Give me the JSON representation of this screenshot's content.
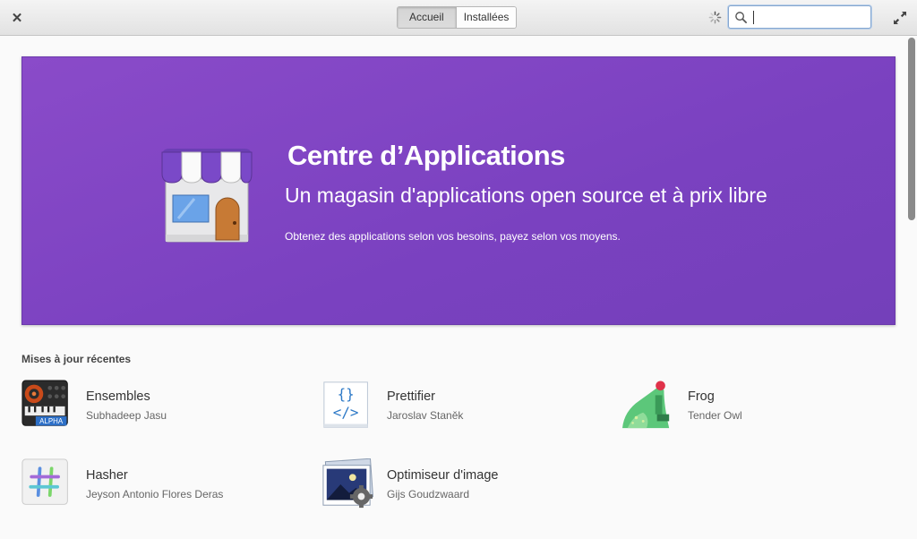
{
  "header": {
    "tabs": [
      {
        "label": "Accueil",
        "active": true
      },
      {
        "label": "Installées",
        "active": false
      }
    ],
    "search": {
      "value": "",
      "placeholder": ""
    }
  },
  "banner": {
    "title": "Centre d’Applications",
    "subtitle": "Un magasin d'applications open source et à prix libre",
    "description": "Obtenez des applications selon vos besoins, payez selon vos moyens.",
    "background": "#7c43c2"
  },
  "recent": {
    "title": "Mises à jour récentes",
    "apps": [
      {
        "name": "Ensembles",
        "author": "Subhadeep Jasu",
        "badge": "ALPHA",
        "icon": "speaker-icon"
      },
      {
        "name": "Prettifier",
        "author": "Jaroslav Staněk",
        "icon": "code-icon"
      },
      {
        "name": "Frog",
        "author": "Tender Owl",
        "icon": "frog-icon"
      },
      {
        "name": "Hasher",
        "author": "Jeyson Antonio Flores Deras",
        "icon": "hash-icon"
      },
      {
        "name": "Optimiseur d'image",
        "author": "Gijs Goudzwaard",
        "icon": "image-gear-icon"
      }
    ]
  }
}
